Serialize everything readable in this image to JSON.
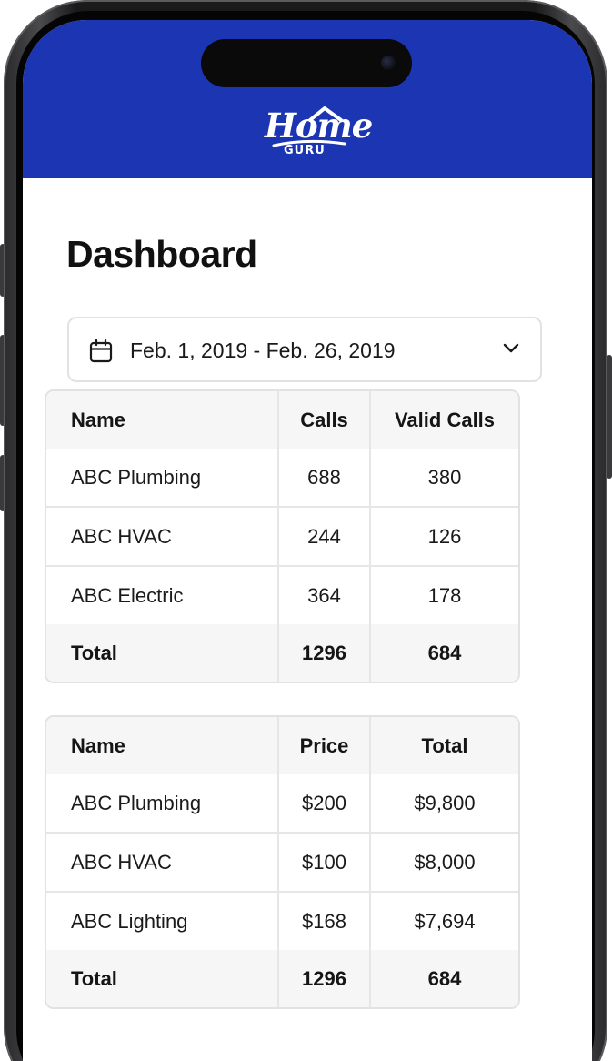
{
  "brand": {
    "logo_word": "Home",
    "logo_sub": "GURU",
    "header_color": "#1b35b3"
  },
  "page": {
    "title": "Dashboard"
  },
  "date_range": {
    "icon": "calendar-icon",
    "value": "Feb. 1, 2019 - Feb. 26, 2019",
    "dropdown_icon": "chevron-down-icon"
  },
  "calls_table": {
    "columns": [
      "Name",
      "Calls",
      "Valid Calls"
    ],
    "rows": [
      {
        "name": "ABC Plumbing",
        "calls": "688",
        "valid_calls": "380"
      },
      {
        "name": "ABC HVAC",
        "calls": "244",
        "valid_calls": "126"
      },
      {
        "name": "ABC Electric",
        "calls": "364",
        "valid_calls": "178"
      }
    ],
    "total": {
      "label": "Total",
      "calls": "1296",
      "valid_calls": "684"
    }
  },
  "sales_table": {
    "columns": [
      "Name",
      "Price",
      "Total"
    ],
    "rows": [
      {
        "name": "ABC Plumbing",
        "price": "$200",
        "total": "$9,800"
      },
      {
        "name": "ABC HVAC",
        "price": "$100",
        "total": "$8,000"
      },
      {
        "name": "ABC Lighting",
        "price": "$168",
        "total": "$7,694"
      }
    ],
    "total": {
      "label": "Total",
      "price": "1296",
      "total": "684"
    }
  }
}
